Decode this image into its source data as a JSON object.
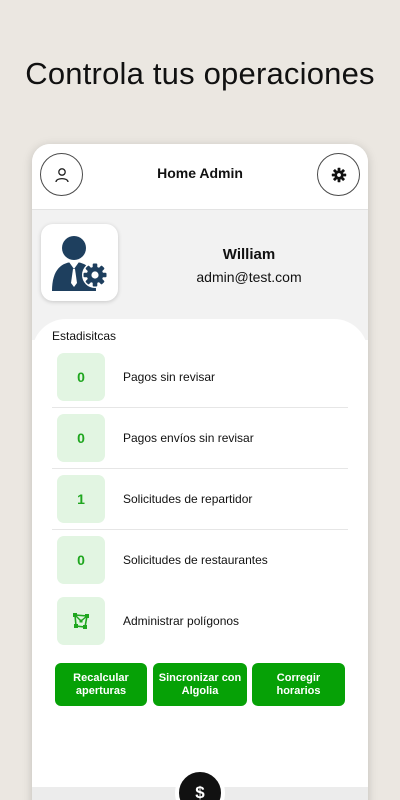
{
  "headline": "Controla tus operaciones",
  "appbar": {
    "title": "Home Admin",
    "left_icon": "user-icon",
    "right_icon": "gear-icon"
  },
  "profile": {
    "name": "William",
    "email": "admin@test.com",
    "avatar_icon": "admin-settings-icon"
  },
  "stats": {
    "title": "Estadisitcas",
    "items": [
      {
        "value": "0",
        "label": "Pagos sin revisar"
      },
      {
        "value": "0",
        "label": "Pagos envíos sin revisar"
      },
      {
        "value": "1",
        "label": "Solicitudes de repartidor"
      },
      {
        "value": "0",
        "label": "Solicitudes de restaurantes"
      },
      {
        "icon": "polygon-icon",
        "label": "Administrar polígonos"
      }
    ]
  },
  "actions": [
    {
      "label": "Recalcular aperturas"
    },
    {
      "label": "Sincronizar con Algolia"
    },
    {
      "label": "Corregir horarios"
    }
  ],
  "fab": {
    "label": "$"
  },
  "colors": {
    "accent": "#06a106",
    "stat_bg": "#e2f5e2",
    "stat_text": "#1fa61f",
    "background": "#ebe7e1"
  }
}
